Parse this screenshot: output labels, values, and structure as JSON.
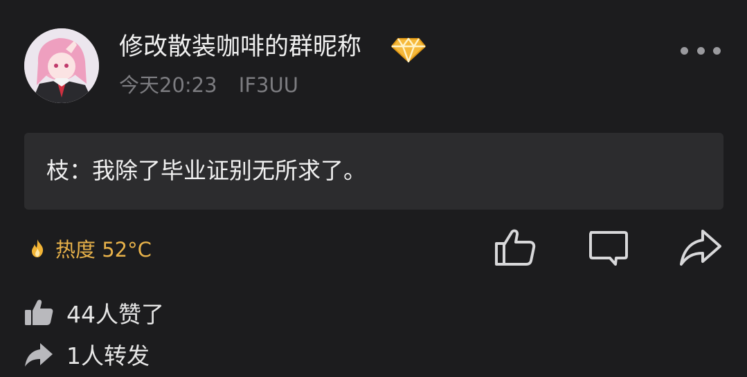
{
  "post": {
    "username": "修改散装咖啡的群昵称",
    "time": "今天20:23",
    "source": "IF3UU",
    "content": "枝：我除了毕业证别无所求了。",
    "heat": "热度 52°C",
    "likes_text": "44人赞了",
    "reposts_text": "1人转发"
  },
  "icons": {
    "avatar": "anime-avatar",
    "badge": "diamond-vip-icon",
    "more": "more-dots-icon",
    "heat": "flame-icon",
    "like": "thumbs-up-icon",
    "comment": "comment-icon",
    "share": "share-arrow-icon",
    "likes_stat": "thumbs-up-filled-icon",
    "reposts_stat": "share-arrow-filled-icon"
  },
  "colors": {
    "background": "#1c1c1e",
    "content_box": "#2c2c2e",
    "heat": "#e8b24a",
    "muted": "#7c7c80",
    "diamond": "#f6b93b"
  }
}
